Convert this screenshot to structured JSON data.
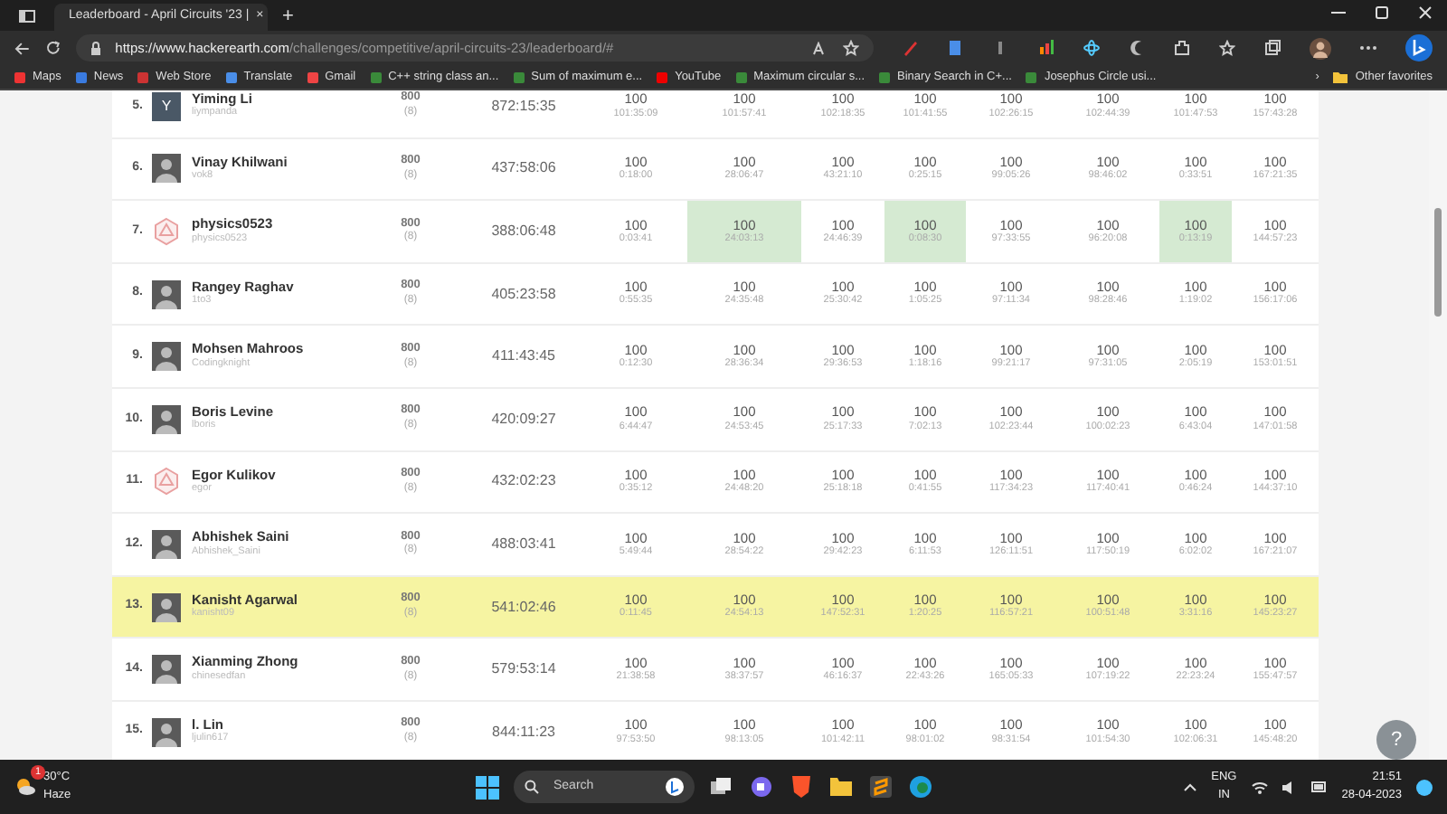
{
  "browser": {
    "tab_title": "Leaderboard - April Circuits '23 |",
    "tab_close": "×",
    "new_tab": "+",
    "url_host": "https://www.hackerearth.com",
    "url_path": "/challenges/competitive/april-circuits-23/leaderboard/#",
    "bookmarks": [
      {
        "label": "Maps"
      },
      {
        "label": "News"
      },
      {
        "label": "Web Store"
      },
      {
        "label": "Translate"
      },
      {
        "label": "Gmail"
      },
      {
        "label": "C++ string class an..."
      },
      {
        "label": "Sum of maximum e..."
      },
      {
        "label": "YouTube"
      },
      {
        "label": "Maximum circular s..."
      },
      {
        "label": "Binary Search in C+..."
      },
      {
        "label": "Josephus Circle usi..."
      }
    ],
    "more_bookmarks": "›",
    "other_favorites": "Other favorites"
  },
  "leaderboard": {
    "rows": [
      {
        "rank": "5.",
        "name": "Yiming Li",
        "handle": "liympanda",
        "avatar": {
          "kind": "letter",
          "letter": "Y"
        },
        "score": "800",
        "solved": "(8)",
        "time": "872:15:35",
        "highlighted": false,
        "cells": [
          {
            "score": "100",
            "time": "101:35:09",
            "first_solve": false
          },
          {
            "score": "100",
            "time": "101:57:41",
            "first_solve": false
          },
          {
            "score": "100",
            "time": "102:18:35",
            "first_solve": false
          },
          {
            "score": "100",
            "time": "101:41:55",
            "first_solve": false
          },
          {
            "score": "100",
            "time": "102:26:15",
            "first_solve": false
          },
          {
            "score": "100",
            "time": "102:44:39",
            "first_solve": false
          },
          {
            "score": "100",
            "time": "101:47:53",
            "first_solve": false
          },
          {
            "score": "100",
            "time": "157:43:28",
            "first_solve": false
          }
        ]
      },
      {
        "rank": "6.",
        "name": "Vinay Khilwani",
        "handle": "vok8",
        "avatar": {
          "kind": "photo"
        },
        "score": "800",
        "solved": "(8)",
        "time": "437:58:06",
        "highlighted": false,
        "cells": [
          {
            "score": "100",
            "time": "0:18:00",
            "first_solve": false
          },
          {
            "score": "100",
            "time": "28:06:47",
            "first_solve": false
          },
          {
            "score": "100",
            "time": "43:21:10",
            "first_solve": false
          },
          {
            "score": "100",
            "time": "0:25:15",
            "first_solve": false
          },
          {
            "score": "100",
            "time": "99:05:26",
            "first_solve": false
          },
          {
            "score": "100",
            "time": "98:46:02",
            "first_solve": false
          },
          {
            "score": "100",
            "time": "0:33:51",
            "first_solve": false
          },
          {
            "score": "100",
            "time": "167:21:35",
            "first_solve": false
          }
        ]
      },
      {
        "rank": "7.",
        "name": "physics0523",
        "handle": "physics0523",
        "avatar": {
          "kind": "logo"
        },
        "score": "800",
        "solved": "(8)",
        "time": "388:06:48",
        "highlighted": false,
        "cells": [
          {
            "score": "100",
            "time": "0:03:41",
            "first_solve": false
          },
          {
            "score": "100",
            "time": "24:03:13",
            "first_solve": true
          },
          {
            "score": "100",
            "time": "24:46:39",
            "first_solve": false
          },
          {
            "score": "100",
            "time": "0:08:30",
            "first_solve": true
          },
          {
            "score": "100",
            "time": "97:33:55",
            "first_solve": false
          },
          {
            "score": "100",
            "time": "96:20:08",
            "first_solve": false
          },
          {
            "score": "100",
            "time": "0:13:19",
            "first_solve": true
          },
          {
            "score": "100",
            "time": "144:57:23",
            "first_solve": false
          }
        ]
      },
      {
        "rank": "8.",
        "name": "Rangey Raghav",
        "handle": "1to3",
        "avatar": {
          "kind": "photo"
        },
        "score": "800",
        "solved": "(8)",
        "time": "405:23:58",
        "highlighted": false,
        "cells": [
          {
            "score": "100",
            "time": "0:55:35",
            "first_solve": false
          },
          {
            "score": "100",
            "time": "24:35:48",
            "first_solve": false
          },
          {
            "score": "100",
            "time": "25:30:42",
            "first_solve": false
          },
          {
            "score": "100",
            "time": "1:05:25",
            "first_solve": false
          },
          {
            "score": "100",
            "time": "97:11:34",
            "first_solve": false
          },
          {
            "score": "100",
            "time": "98:28:46",
            "first_solve": false
          },
          {
            "score": "100",
            "time": "1:19:02",
            "first_solve": false
          },
          {
            "score": "100",
            "time": "156:17:06",
            "first_solve": false
          }
        ]
      },
      {
        "rank": "9.",
        "name": "Mohsen Mahroos",
        "handle": "Codingknight",
        "avatar": {
          "kind": "photo"
        },
        "score": "800",
        "solved": "(8)",
        "time": "411:43:45",
        "highlighted": false,
        "cells": [
          {
            "score": "100",
            "time": "0:12:30",
            "first_solve": false
          },
          {
            "score": "100",
            "time": "28:36:34",
            "first_solve": false
          },
          {
            "score": "100",
            "time": "29:36:53",
            "first_solve": false
          },
          {
            "score": "100",
            "time": "1:18:16",
            "first_solve": false
          },
          {
            "score": "100",
            "time": "99:21:17",
            "first_solve": false
          },
          {
            "score": "100",
            "time": "97:31:05",
            "first_solve": false
          },
          {
            "score": "100",
            "time": "2:05:19",
            "first_solve": false
          },
          {
            "score": "100",
            "time": "153:01:51",
            "first_solve": false
          }
        ]
      },
      {
        "rank": "10.",
        "name": "Boris Levine",
        "handle": "lboris",
        "avatar": {
          "kind": "photo"
        },
        "score": "800",
        "solved": "(8)",
        "time": "420:09:27",
        "highlighted": false,
        "cells": [
          {
            "score": "100",
            "time": "6:44:47",
            "first_solve": false
          },
          {
            "score": "100",
            "time": "24:53:45",
            "first_solve": false
          },
          {
            "score": "100",
            "time": "25:17:33",
            "first_solve": false
          },
          {
            "score": "100",
            "time": "7:02:13",
            "first_solve": false
          },
          {
            "score": "100",
            "time": "102:23:44",
            "first_solve": false
          },
          {
            "score": "100",
            "time": "100:02:23",
            "first_solve": false
          },
          {
            "score": "100",
            "time": "6:43:04",
            "first_solve": false
          },
          {
            "score": "100",
            "time": "147:01:58",
            "first_solve": false
          }
        ]
      },
      {
        "rank": "11.",
        "name": "Egor Kulikov",
        "handle": "egor",
        "avatar": {
          "kind": "logo"
        },
        "score": "800",
        "solved": "(8)",
        "time": "432:02:23",
        "highlighted": false,
        "cells": [
          {
            "score": "100",
            "time": "0:35:12",
            "first_solve": false
          },
          {
            "score": "100",
            "time": "24:48:20",
            "first_solve": false
          },
          {
            "score": "100",
            "time": "25:18:18",
            "first_solve": false
          },
          {
            "score": "100",
            "time": "0:41:55",
            "first_solve": false
          },
          {
            "score": "100",
            "time": "117:34:23",
            "first_solve": false
          },
          {
            "score": "100",
            "time": "117:40:41",
            "first_solve": false
          },
          {
            "score": "100",
            "time": "0:46:24",
            "first_solve": false
          },
          {
            "score": "100",
            "time": "144:37:10",
            "first_solve": false
          }
        ]
      },
      {
        "rank": "12.",
        "name": "Abhishek Saini",
        "handle": "Abhishek_Saini",
        "avatar": {
          "kind": "photo"
        },
        "score": "800",
        "solved": "(8)",
        "time": "488:03:41",
        "highlighted": false,
        "cells": [
          {
            "score": "100",
            "time": "5:49:44",
            "first_solve": false
          },
          {
            "score": "100",
            "time": "28:54:22",
            "first_solve": false
          },
          {
            "score": "100",
            "time": "29:42:23",
            "first_solve": false
          },
          {
            "score": "100",
            "time": "6:11:53",
            "first_solve": false
          },
          {
            "score": "100",
            "time": "126:11:51",
            "first_solve": false
          },
          {
            "score": "100",
            "time": "117:50:19",
            "first_solve": false
          },
          {
            "score": "100",
            "time": "6:02:02",
            "first_solve": false
          },
          {
            "score": "100",
            "time": "167:21:07",
            "first_solve": false
          }
        ]
      },
      {
        "rank": "13.",
        "name": "Kanisht Agarwal",
        "handle": "kanisht09",
        "avatar": {
          "kind": "photo"
        },
        "score": "800",
        "solved": "(8)",
        "time": "541:02:46",
        "highlighted": true,
        "cells": [
          {
            "score": "100",
            "time": "0:11:45",
            "first_solve": false
          },
          {
            "score": "100",
            "time": "24:54:13",
            "first_solve": false
          },
          {
            "score": "100",
            "time": "147:52:31",
            "first_solve": false
          },
          {
            "score": "100",
            "time": "1:20:25",
            "first_solve": false
          },
          {
            "score": "100",
            "time": "116:57:21",
            "first_solve": false
          },
          {
            "score": "100",
            "time": "100:51:48",
            "first_solve": false
          },
          {
            "score": "100",
            "time": "3:31:16",
            "first_solve": false
          },
          {
            "score": "100",
            "time": "145:23:27",
            "first_solve": false
          }
        ]
      },
      {
        "rank": "14.",
        "name": "Xianming Zhong",
        "handle": "chinesedfan",
        "avatar": {
          "kind": "photo"
        },
        "score": "800",
        "solved": "(8)",
        "time": "579:53:14",
        "highlighted": false,
        "cells": [
          {
            "score": "100",
            "time": "21:38:58",
            "first_solve": false
          },
          {
            "score": "100",
            "time": "38:37:57",
            "first_solve": false
          },
          {
            "score": "100",
            "time": "46:16:37",
            "first_solve": false
          },
          {
            "score": "100",
            "time": "22:43:26",
            "first_solve": false
          },
          {
            "score": "100",
            "time": "165:05:33",
            "first_solve": false
          },
          {
            "score": "100",
            "time": "107:19:22",
            "first_solve": false
          },
          {
            "score": "100",
            "time": "22:23:24",
            "first_solve": false
          },
          {
            "score": "100",
            "time": "155:47:57",
            "first_solve": false
          }
        ]
      },
      {
        "rank": "15.",
        "name": "l. Lin",
        "handle": "ljulin617",
        "avatar": {
          "kind": "photo"
        },
        "score": "800",
        "solved": "(8)",
        "time": "844:11:23",
        "highlighted": false,
        "cells": [
          {
            "score": "100",
            "time": "97:53:50",
            "first_solve": false
          },
          {
            "score": "100",
            "time": "98:13:05",
            "first_solve": false
          },
          {
            "score": "100",
            "time": "101:42:11",
            "first_solve": false
          },
          {
            "score": "100",
            "time": "98:01:02",
            "first_solve": false
          },
          {
            "score": "100",
            "time": "98:31:54",
            "first_solve": false
          },
          {
            "score": "100",
            "time": "101:54:30",
            "first_solve": false
          },
          {
            "score": "100",
            "time": "102:06:31",
            "first_solve": false
          },
          {
            "score": "100",
            "time": "145:48:20",
            "first_solve": false
          }
        ]
      }
    ]
  },
  "help_button": "?",
  "taskbar": {
    "temperature": "30°C",
    "weather": "Haze",
    "weather_badge": "1",
    "search_placeholder": "Search",
    "language": "ENG",
    "region": "IN",
    "time": "21:51",
    "date": "28-04-2023"
  }
}
